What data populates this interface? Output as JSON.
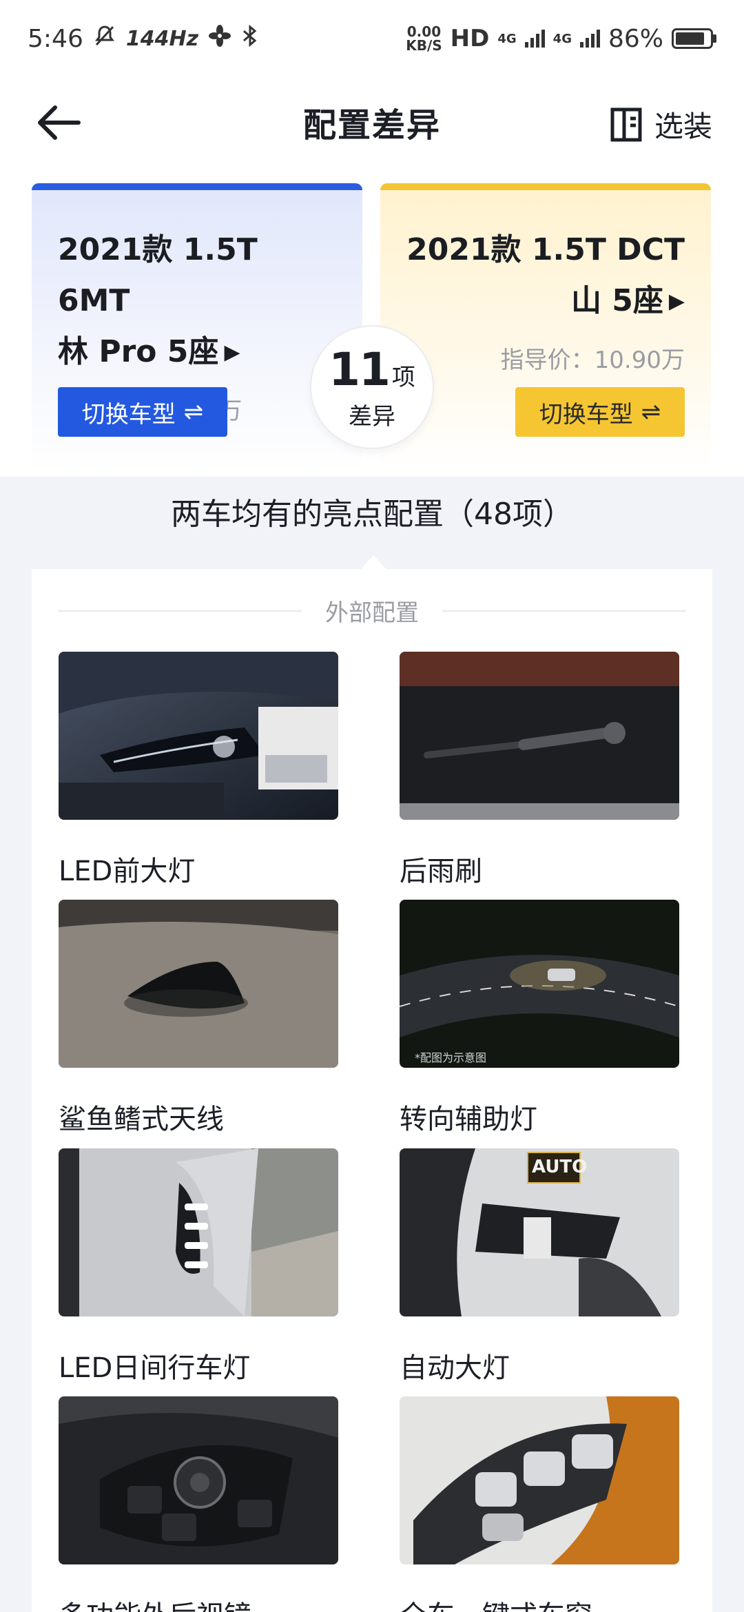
{
  "status_bar": {
    "time": "5:46",
    "refresh_rate": "144Hz",
    "net_speed_value": "0.00",
    "net_speed_unit": "KB/S",
    "hd_label": "HD",
    "sim1_label": "4G",
    "sim2_label": "4G",
    "battery_percent": "86%"
  },
  "nav": {
    "title": "配置差异",
    "option_label": "选装"
  },
  "compare": {
    "left": {
      "line1": "2021款 1.5T 6MT",
      "line2": "林 Pro 5座",
      "price": "指导价：10.19万",
      "switch_label": "切换车型",
      "accent": "#2a5cdf"
    },
    "right": {
      "line1": "2021款 1.5T DCT",
      "line2": "山 5座",
      "price": "指导价：10.90万",
      "switch_label": "切换车型",
      "accent": "#f4c433"
    },
    "diff_count": "11",
    "diff_unit": "项",
    "diff_label": "差异"
  },
  "shared": {
    "title": "两车均有的亮点配置（48项）",
    "section": "外部配置",
    "items": [
      {
        "label": "LED前大灯",
        "watermark": ""
      },
      {
        "label": "后雨刷",
        "watermark": ""
      },
      {
        "label": "鲨鱼鳍式天线",
        "watermark": ""
      },
      {
        "label": "转向辅助灯",
        "watermark": "*配图为示意图"
      },
      {
        "label": "LED日间行车灯",
        "watermark": ""
      },
      {
        "label": "自动大灯",
        "watermark": "AUTO"
      },
      {
        "label": "多功能外后视镜",
        "watermark": ""
      },
      {
        "label": "全车一键式车窗",
        "watermark": ""
      }
    ]
  }
}
